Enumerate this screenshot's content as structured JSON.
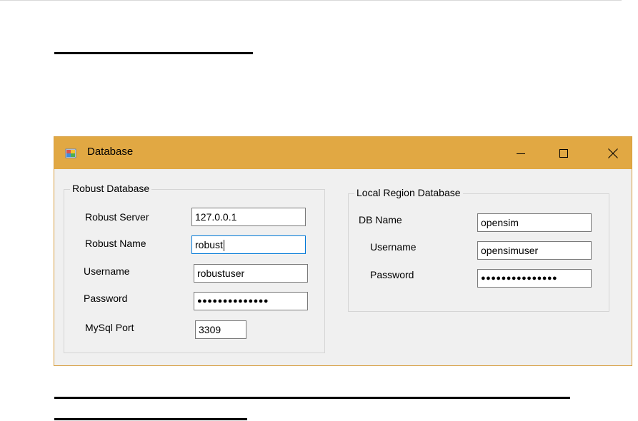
{
  "window": {
    "title": "Database",
    "colors": {
      "titlebar": "#e1a843",
      "focus_border": "#0078d7"
    }
  },
  "robust": {
    "group_title": "Robust Database",
    "server_label": "Robust Server",
    "server_value": "127.0.0.1",
    "name_label": "Robust Name",
    "name_value": "robust",
    "username_label": "Username",
    "username_value": "robustuser",
    "password_label": "Password",
    "password_mask": "●●●●●●●●●●●●●●",
    "port_label": "MySql Port",
    "port_value": "3309"
  },
  "local": {
    "group_title": "Local Region Database",
    "dbname_label": "DB Name",
    "dbname_value": "opensim",
    "username_label": "Username",
    "username_value": "opensimuser",
    "password_label": "Password",
    "password_mask": "●●●●●●●●●●●●●●●"
  },
  "icons": [
    "app-icon",
    "minimize-icon",
    "maximize-icon",
    "close-icon"
  ]
}
